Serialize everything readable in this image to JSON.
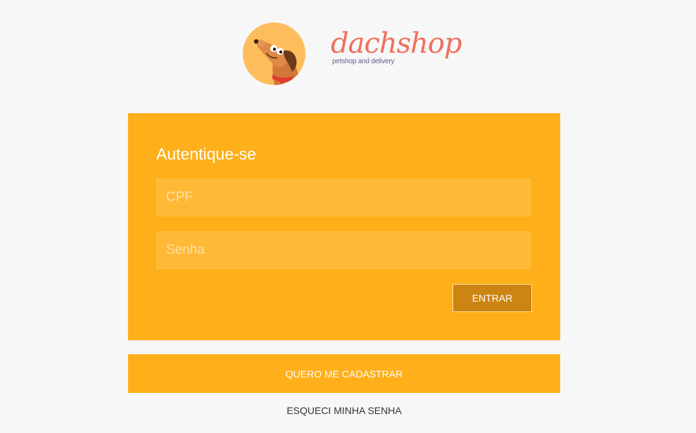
{
  "brand": {
    "name": "dachshop",
    "tagline": "petshop and delivery"
  },
  "login": {
    "title": "Autentique-se",
    "cpf_placeholder": "CPF",
    "senha_placeholder": "Senha",
    "submit_label": "ENTRAR"
  },
  "actions": {
    "register_label": "QUERO ME CADASTRAR",
    "forgot_label": "ESQUECI MINHA SENHA"
  },
  "colors": {
    "background": "#f7f7f7",
    "card": "#ffaf1a",
    "submit_button": "#cc8512",
    "brand_text": "#ef6f5c",
    "logo_circle": "#fdbd5c"
  },
  "icons": {
    "logo": "dachshund-dog-icon"
  }
}
